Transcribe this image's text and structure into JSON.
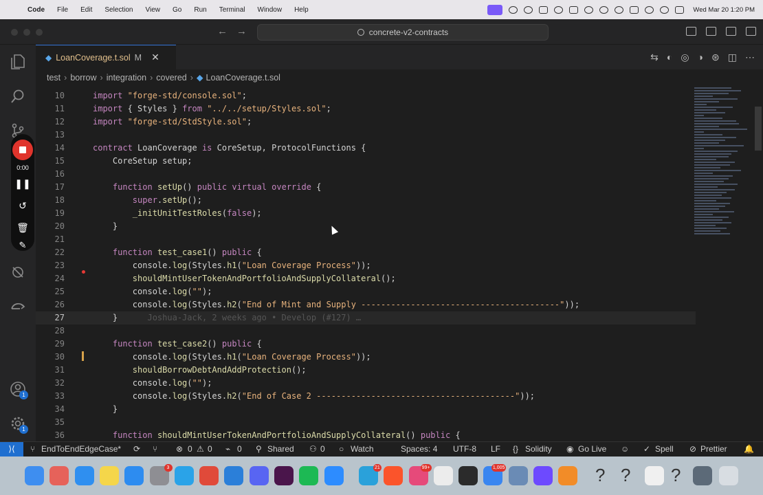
{
  "menubar": {
    "app_name": "Code",
    "items": [
      "File",
      "Edit",
      "Selection",
      "View",
      "Go",
      "Run",
      "Terminal",
      "Window",
      "Help"
    ],
    "clock": "Wed Mar 20  1:20 PM"
  },
  "titlebar": {
    "search_text": "concrete-v2-contracts"
  },
  "recorder": {
    "time": "0:00"
  },
  "tab": {
    "filename": "LoanCoverage.t.sol",
    "status": "M"
  },
  "breadcrumb": {
    "items": [
      "test",
      "borrow",
      "integration",
      "covered",
      "LoanCoverage.t.sol"
    ]
  },
  "activity": {
    "accounts_badge": "1",
    "settings_badge": "1"
  },
  "editor": {
    "current_line": 27,
    "git_blame": "Joshua-Jack, 2 weeks ago • Develop (#127) …",
    "lines": [
      {
        "n": "10",
        "t": "import \"forge-std/console.sol\";"
      },
      {
        "n": "11",
        "t": "import { Styles } from \"../../setup/Styles.sol\";"
      },
      {
        "n": "12",
        "t": "import \"forge-std/StdStyle.sol\";"
      },
      {
        "n": "13",
        "t": ""
      },
      {
        "n": "14",
        "t": "contract LoanCoverage is CoreSetup, ProtocolFunctions {"
      },
      {
        "n": "15",
        "t": "    CoreSetup setup;"
      },
      {
        "n": "16",
        "t": ""
      },
      {
        "n": "17",
        "t": "    function setUp() public virtual override {"
      },
      {
        "n": "18",
        "t": "        super.setUp();"
      },
      {
        "n": "19",
        "t": "        _initUnitTestRoles(false);"
      },
      {
        "n": "20",
        "t": "    }"
      },
      {
        "n": "21",
        "t": ""
      },
      {
        "n": "22",
        "t": "    function test_case1() public {"
      },
      {
        "n": "23",
        "t": "        console.log(Styles.h1(\"Loan Coverage Process\"));"
      },
      {
        "n": "24",
        "t": "        shouldMintUserTokenAndPortfolioAndSupplyCollateral();"
      },
      {
        "n": "25",
        "t": "        console.log(\"\");"
      },
      {
        "n": "26",
        "t": "        console.log(Styles.h2(\"End of Mint and Supply ----------------------------------------\"));"
      },
      {
        "n": "27",
        "t": "    }"
      },
      {
        "n": "28",
        "t": ""
      },
      {
        "n": "29",
        "t": "    function test_case2() public {"
      },
      {
        "n": "30",
        "t": "        console.log(Styles.h1(\"Loan Coverage Process\"));"
      },
      {
        "n": "31",
        "t": "        shouldBorrowDebtAndAddProtection();"
      },
      {
        "n": "32",
        "t": "        console.log(\"\");"
      },
      {
        "n": "33",
        "t": "        console.log(Styles.h2(\"End of Case 2 ----------------------------------------\"));"
      },
      {
        "n": "34",
        "t": "    }"
      },
      {
        "n": "35",
        "t": ""
      },
      {
        "n": "36",
        "t": "    function shouldMintUserTokenAndPortfolioAndSupplyCollateral() public {"
      }
    ]
  },
  "statusbar": {
    "branch": "EndToEndEdgeCase*",
    "errors": "0",
    "warnings": "0",
    "ports": "0",
    "shared": "Shared",
    "live_share_count": "0",
    "watch": "Watch",
    "spaces": "Spaces: 4",
    "encoding": "UTF-8",
    "eol": "LF",
    "language": "Solidity",
    "go_live": "Go Live",
    "spell": "Spell",
    "prettier": "Prettier"
  },
  "dock": {
    "badges": {
      "settings": "3",
      "telegram": "21",
      "spark": "99+",
      "mail": "1,005"
    },
    "apps": [
      {
        "name": "finder",
        "color": "#3e8ef0"
      },
      {
        "name": "launchpad",
        "color": "#e6625a"
      },
      {
        "name": "safari",
        "color": "#2f8ff0"
      },
      {
        "name": "notes",
        "color": "#f5d64a"
      },
      {
        "name": "app-store",
        "color": "#2d8cf0"
      },
      {
        "name": "system-settings",
        "color": "#8e8e93"
      },
      {
        "name": "dropzone",
        "color": "#2aa3e8"
      },
      {
        "name": "chrome",
        "color": "#e04a3a"
      },
      {
        "name": "vscode",
        "color": "#2b7fd9"
      },
      {
        "name": "discord",
        "color": "#5865f2"
      },
      {
        "name": "slack",
        "color": "#4a154b"
      },
      {
        "name": "spotify",
        "color": "#1db954"
      },
      {
        "name": "zoom",
        "color": "#2d8cff"
      },
      {
        "name": "telegram",
        "color": "#2aa1da"
      },
      {
        "name": "brave",
        "color": "#fb542b"
      },
      {
        "name": "spark",
        "color": "#e64a7a"
      },
      {
        "name": "textedit",
        "color": "#ececec"
      },
      {
        "name": "terminal",
        "color": "#2b2b2b"
      },
      {
        "name": "mail",
        "color": "#3a86f0"
      },
      {
        "name": "preview",
        "color": "#6a8bb5"
      },
      {
        "name": "proton",
        "color": "#6d4aff"
      },
      {
        "name": "sublime",
        "color": "#f28c28"
      }
    ]
  }
}
